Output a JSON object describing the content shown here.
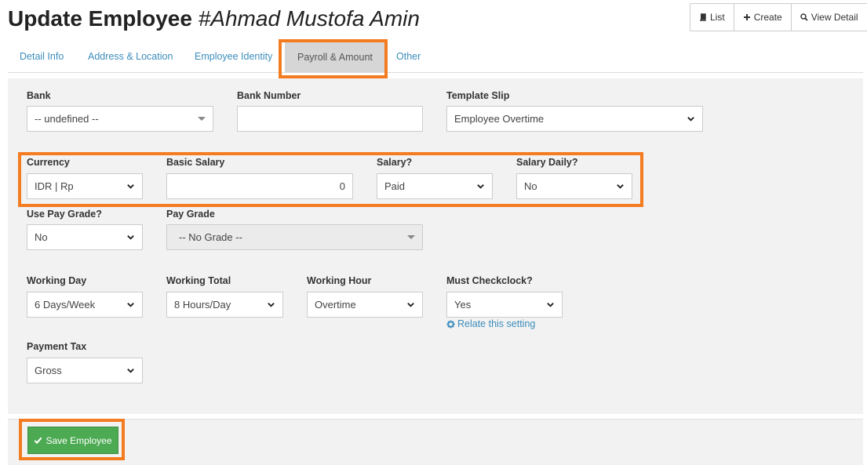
{
  "page": {
    "title_prefix": "Update Employee ",
    "title_name": "#Ahmad Mustofa Amin"
  },
  "actions": {
    "list_label": "List",
    "create_label": "Create",
    "view_detail_label": "View Detail"
  },
  "tabs": [
    {
      "label": "Detail Info",
      "active": false
    },
    {
      "label": "Address & Location",
      "active": false
    },
    {
      "label": "Employee Identity",
      "active": false
    },
    {
      "label": "Payroll & Amount",
      "active": true
    },
    {
      "label": "Other",
      "active": false
    }
  ],
  "form": {
    "bank": {
      "label": "Bank",
      "value": "-- undefined --"
    },
    "bank_number": {
      "label": "Bank Number",
      "value": ""
    },
    "template_slip": {
      "label": "Template Slip",
      "value": "Employee Overtime"
    },
    "currency": {
      "label": "Currency",
      "value": "IDR | Rp"
    },
    "basic_salary": {
      "label": "Basic Salary",
      "value": "0"
    },
    "salary": {
      "label": "Salary?",
      "value": "Paid"
    },
    "salary_daily": {
      "label": "Salary Daily?",
      "value": "No"
    },
    "use_pay_grade": {
      "label": "Use Pay Grade?",
      "value": "No"
    },
    "pay_grade": {
      "label": "Pay Grade",
      "value": "-- No Grade --"
    },
    "working_day": {
      "label": "Working Day",
      "value": "6 Days/Week"
    },
    "working_total": {
      "label": "Working Total",
      "value": "8 Hours/Day"
    },
    "working_hour": {
      "label": "Working Hour",
      "value": "Overtime"
    },
    "must_checkclock": {
      "label": "Must Checkclock?",
      "value": "Yes"
    },
    "relate_setting": "Relate this setting",
    "payment_tax": {
      "label": "Payment Tax",
      "value": "Gross"
    }
  },
  "footer": {
    "save_label": "Save Employee"
  },
  "colors": {
    "link": "#3c8dbc",
    "highlight": "#f47c20",
    "save": "#4caa52"
  },
  "icons": {
    "list": "book-icon",
    "create": "plus-icon",
    "view_detail": "search-icon",
    "relate": "gear-icon",
    "save": "check-icon"
  }
}
